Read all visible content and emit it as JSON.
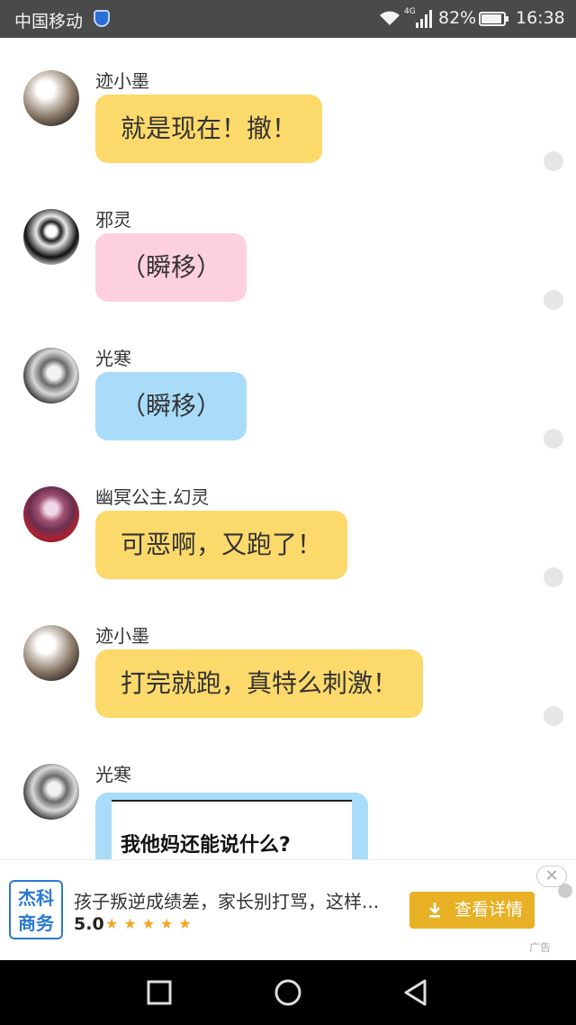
{
  "status_bar": {
    "carrier": "中国移动",
    "network": "4G",
    "battery": "82%",
    "time": "16:38"
  },
  "messages": [
    {
      "sender": "迹小墨",
      "text": "就是现在！撤！",
      "bubble_color": "#fcd96b",
      "avatar": "ink-girl-avatar"
    },
    {
      "sender": "邪灵",
      "text": "（瞬移）",
      "bubble_color": "#fdd0de",
      "avatar": "evil-spirit-avatar"
    },
    {
      "sender": "光寒",
      "text": "（瞬移）",
      "bubble_color": "#a8dcf8",
      "avatar": "cold-light-avatar"
    },
    {
      "sender": "幽冥公主.幻灵",
      "text": "可恶啊，又跑了！",
      "bubble_color": "#fcd96b",
      "avatar": "ghost-princess-avatar"
    },
    {
      "sender": "迹小墨",
      "text": "打完就跑，真特么刺激！",
      "bubble_color": "#fcd96b",
      "avatar": "ink-girl-avatar"
    },
    {
      "sender": "光寒",
      "image_text": "我他妈还能说什么?",
      "bubble_color": "#a8dcf8",
      "avatar": "cold-light-avatar"
    }
  ],
  "ad": {
    "logo_line1": "杰科",
    "logo_line2": "商务",
    "title": "孩子叛逆成绩差，家长别打骂，这样...",
    "rating": "5.0",
    "stars": "★★★★★",
    "button_label": "查看详情",
    "close": "✕",
    "tag": "广告"
  }
}
